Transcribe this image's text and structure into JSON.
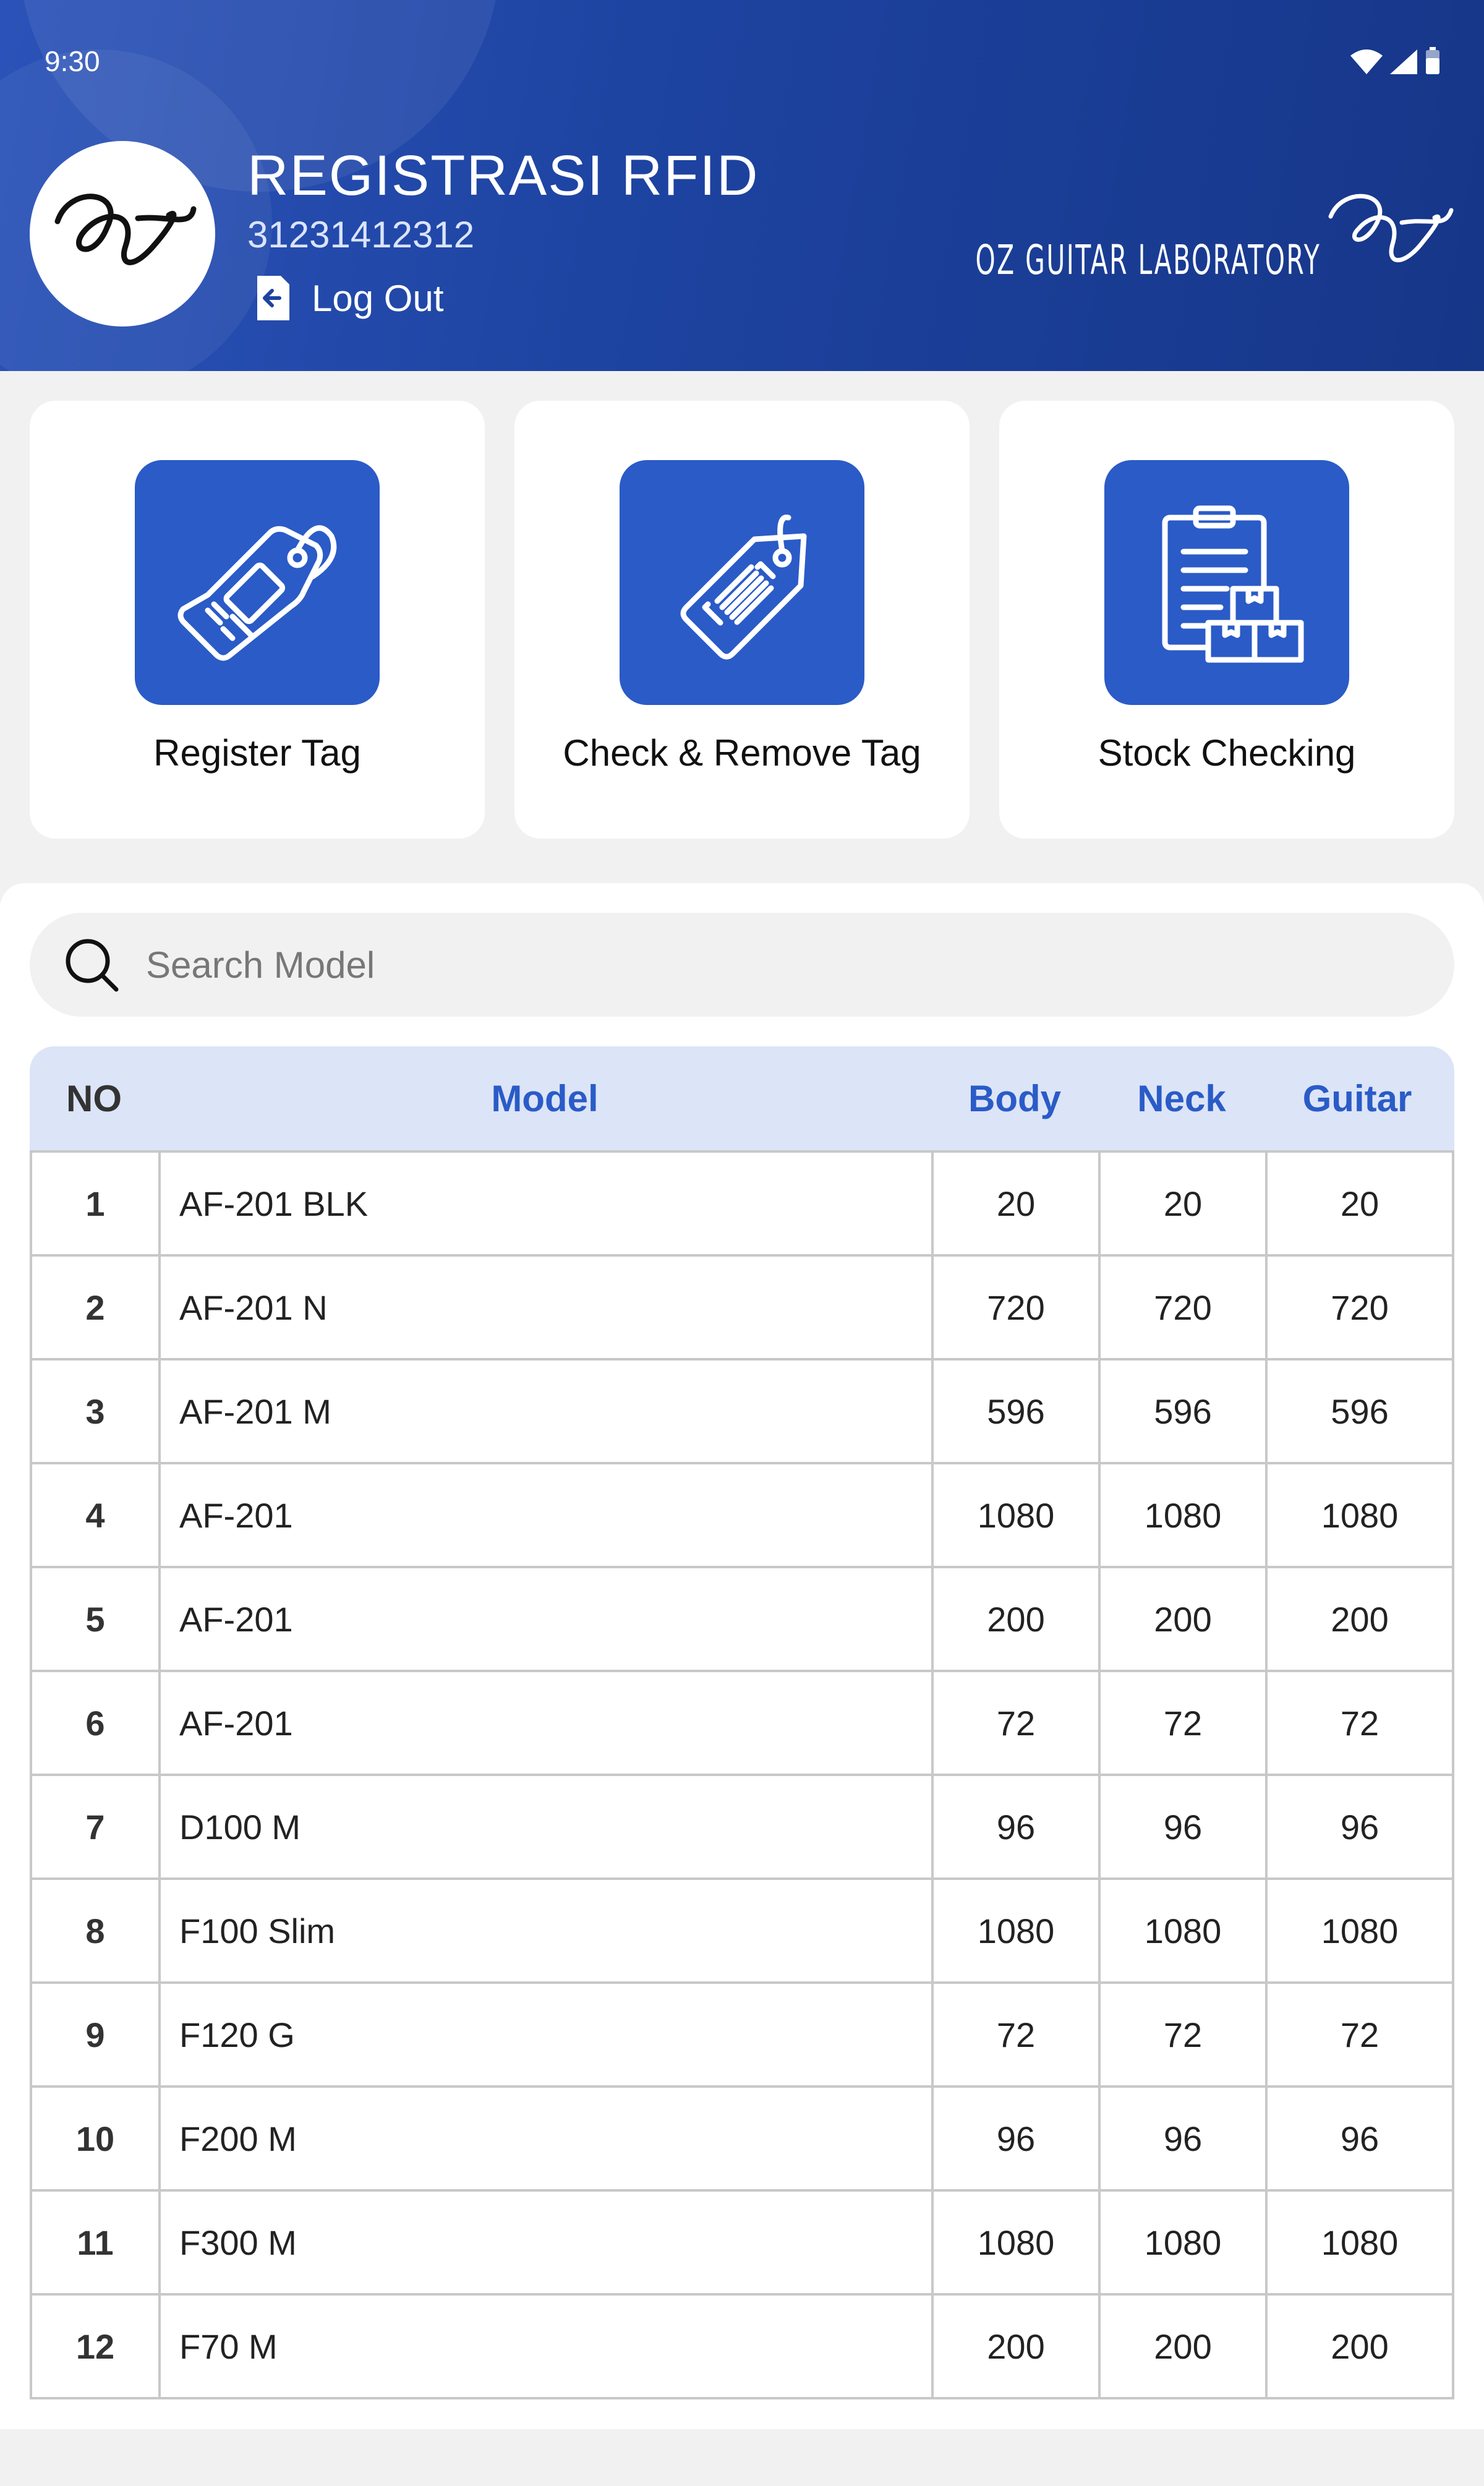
{
  "status_bar": {
    "time": "9:30",
    "icons": [
      "wifi-icon",
      "cellular-signal-icon",
      "battery-icon"
    ]
  },
  "header": {
    "title": "REGISTRASI RFID",
    "user_id": "31231412312",
    "logout_label": "Log Out",
    "brand_name": "OZ GUITAR LABORATORY"
  },
  "actions": [
    {
      "label": "Register Tag",
      "icon": "rfid-tag-icon"
    },
    {
      "label": "Check & Remove Tag",
      "icon": "barcode-tag-icon"
    },
    {
      "label": "Stock Checking",
      "icon": "clipboard-boxes-icon"
    }
  ],
  "search": {
    "placeholder": "Search Model",
    "value": ""
  },
  "table": {
    "headers": {
      "no": "NO",
      "model": "Model",
      "body": "Body",
      "neck": "Neck",
      "guitar": "Guitar"
    },
    "rows": [
      {
        "no": "1",
        "model": "AF-201 BLK",
        "body": "20",
        "neck": "20",
        "guitar": "20"
      },
      {
        "no": "2",
        "model": "AF-201 N",
        "body": "720",
        "neck": "720",
        "guitar": "720"
      },
      {
        "no": "3",
        "model": "AF-201 M",
        "body": "596",
        "neck": "596",
        "guitar": "596"
      },
      {
        "no": "4",
        "model": "AF-201",
        "body": "1080",
        "neck": "1080",
        "guitar": "1080"
      },
      {
        "no": "5",
        "model": "AF-201",
        "body": "200",
        "neck": "200",
        "guitar": "200"
      },
      {
        "no": "6",
        "model": "AF-201",
        "body": "72",
        "neck": "72",
        "guitar": "72"
      },
      {
        "no": "7",
        "model": "D100 M",
        "body": "96",
        "neck": "96",
        "guitar": "96"
      },
      {
        "no": "8",
        "model": "F100 Slim",
        "body": "1080",
        "neck": "1080",
        "guitar": "1080"
      },
      {
        "no": "9",
        "model": "F120 G",
        "body": "72",
        "neck": "72",
        "guitar": "72"
      },
      {
        "no": "10",
        "model": "F200 M",
        "body": "96",
        "neck": "96",
        "guitar": "96"
      },
      {
        "no": "11",
        "model": "F300 M",
        "body": "1080",
        "neck": "1080",
        "guitar": "1080"
      },
      {
        "no": "12",
        "model": "F70 M",
        "body": "200",
        "neck": "200",
        "guitar": "200"
      }
    ]
  },
  "colors": {
    "header_blue": "#1d43a0",
    "accent_blue": "#2a5bc7",
    "table_header_bg": "#dce4f7"
  }
}
